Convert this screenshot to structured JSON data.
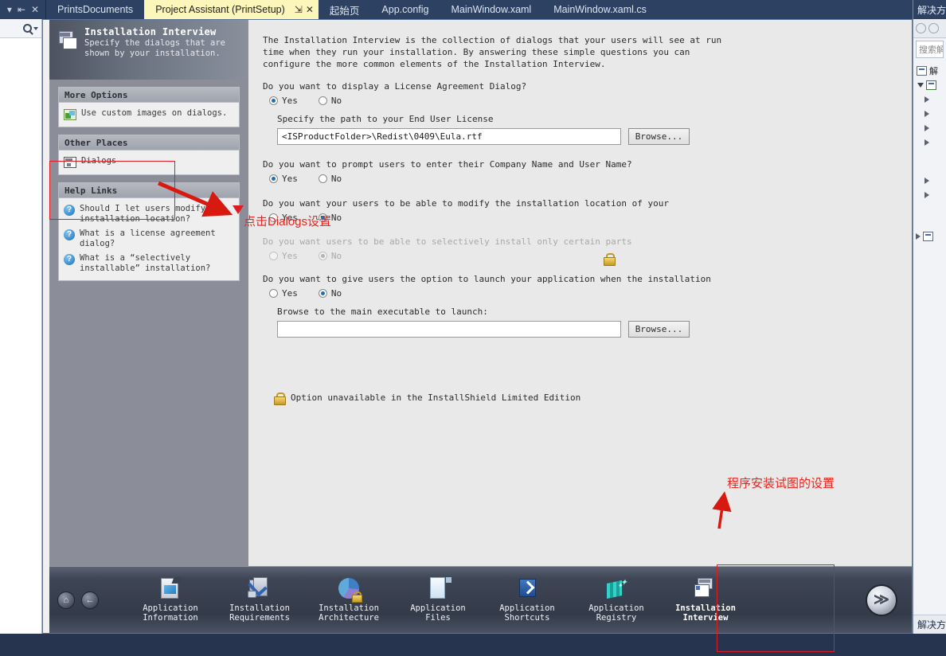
{
  "window": {
    "doc_controls": [
      "dropdown-caret",
      "pin",
      "close"
    ]
  },
  "tabs": [
    {
      "label": "PrintsDocuments",
      "active": false
    },
    {
      "label": "Project Assistant (PrintSetup)",
      "active": true,
      "pin": "⇲",
      "close": "✕"
    },
    {
      "label": "起始页",
      "active": false
    },
    {
      "label": "App.config",
      "active": false
    },
    {
      "label": "MainWindow.xaml",
      "active": false
    },
    {
      "label": "MainWindow.xaml.cs",
      "active": false
    }
  ],
  "tabbar_overflow": "▾",
  "toolbox": {
    "search_icon": "magnifier-icon",
    "caret": "▾"
  },
  "installshield": {
    "banner": {
      "title": "Installation Interview",
      "subtitle": "Specify the dialogs that are shown by your installation."
    },
    "groups": [
      {
        "title": "More Options",
        "items": [
          {
            "icon": "image-icon",
            "label": "Use custom images on dialogs."
          }
        ]
      },
      {
        "title": "Other Places",
        "items": [
          {
            "icon": "dialog-icon",
            "label": "Dialogs"
          }
        ]
      },
      {
        "title": "Help Links",
        "items": [
          {
            "icon": "question-icon",
            "label": "Should I let users modify the installation location?"
          },
          {
            "icon": "question-icon",
            "label": "What is a license agreement dialog?"
          },
          {
            "icon": "question-icon",
            "label": "What is a “selectively installable” installation?"
          }
        ]
      }
    ],
    "intro": "The Installation Interview is the collection of dialogs that your users will see at run time when they run your installation. By answering these simple questions you can configure the more common elements of the Installation Interview.",
    "questions": [
      {
        "text": "Do you want to display a License Agreement Dialog?",
        "selected": "Yes",
        "yes_label": "Yes",
        "no_label": "No",
        "disabled": false,
        "sublabel": "Specify the path to your End User License",
        "input_value": "<ISProductFolder>\\Redist\\0409\\Eula.rtf",
        "browse_label": "Browse..."
      },
      {
        "text": "Do you want to prompt users to enter their Company Name and User Name?",
        "selected": "Yes",
        "yes_label": "Yes",
        "no_label": "No",
        "disabled": false
      },
      {
        "text": "Do you want your users to be able to modify the installation location of your",
        "selected": "No",
        "yes_label": "Yes",
        "no_label": "No",
        "disabled": false
      },
      {
        "text": "Do you want users to be able to selectively install only certain parts",
        "selected": "No",
        "yes_label": "Yes",
        "no_label": "No",
        "disabled": true,
        "lock": "lock-icon"
      },
      {
        "text": "Do you want to give users the option to launch your application when the installation",
        "selected": "No",
        "yes_label": "Yes",
        "no_label": "No",
        "disabled": false,
        "sublabel": "Browse to the main executable to launch:",
        "input_value": "",
        "browse_label": "Browse..."
      }
    ],
    "footnote": {
      "icon": "lock-icon",
      "text": "Option unavailable in the InstallShield Limited Edition"
    },
    "nav": {
      "home_icon": "home-icon",
      "back_icon": "back-arrow-icon",
      "next_icon": "next-arrow-icon",
      "items": [
        {
          "label": "Application\nInformation",
          "icon": "application-information-icon",
          "active": false
        },
        {
          "label": "Installation\nRequirements",
          "icon": "installation-requirements-icon",
          "active": false
        },
        {
          "label": "Installation\nArchitecture",
          "icon": "installation-architecture-icon",
          "active": false
        },
        {
          "label": "Application\nFiles",
          "icon": "application-files-icon",
          "active": false
        },
        {
          "label": "Application\nShortcuts",
          "icon": "application-shortcuts-icon",
          "active": false
        },
        {
          "label": "Application\nRegistry",
          "icon": "application-registry-icon",
          "active": false
        },
        {
          "label": "Installation\nInterview",
          "icon": "installation-interview-icon",
          "active": true
        }
      ]
    }
  },
  "solution_explorer": {
    "title": "解决方",
    "search_placeholder": "搜索解",
    "root_label": "解",
    "bottom_label": "解决方",
    "tree_nodes": [
      "",
      "",
      "",
      "",
      "",
      "",
      "",
      ""
    ]
  },
  "annotations": [
    {
      "text": "点击 Dialogs 设置",
      "display": "点击Dialogs设置",
      "color": "#e8251f"
    },
    {
      "text": "程序安装试图的设置",
      "display": "程序安装试图的设置",
      "color": "#e8251f"
    }
  ]
}
